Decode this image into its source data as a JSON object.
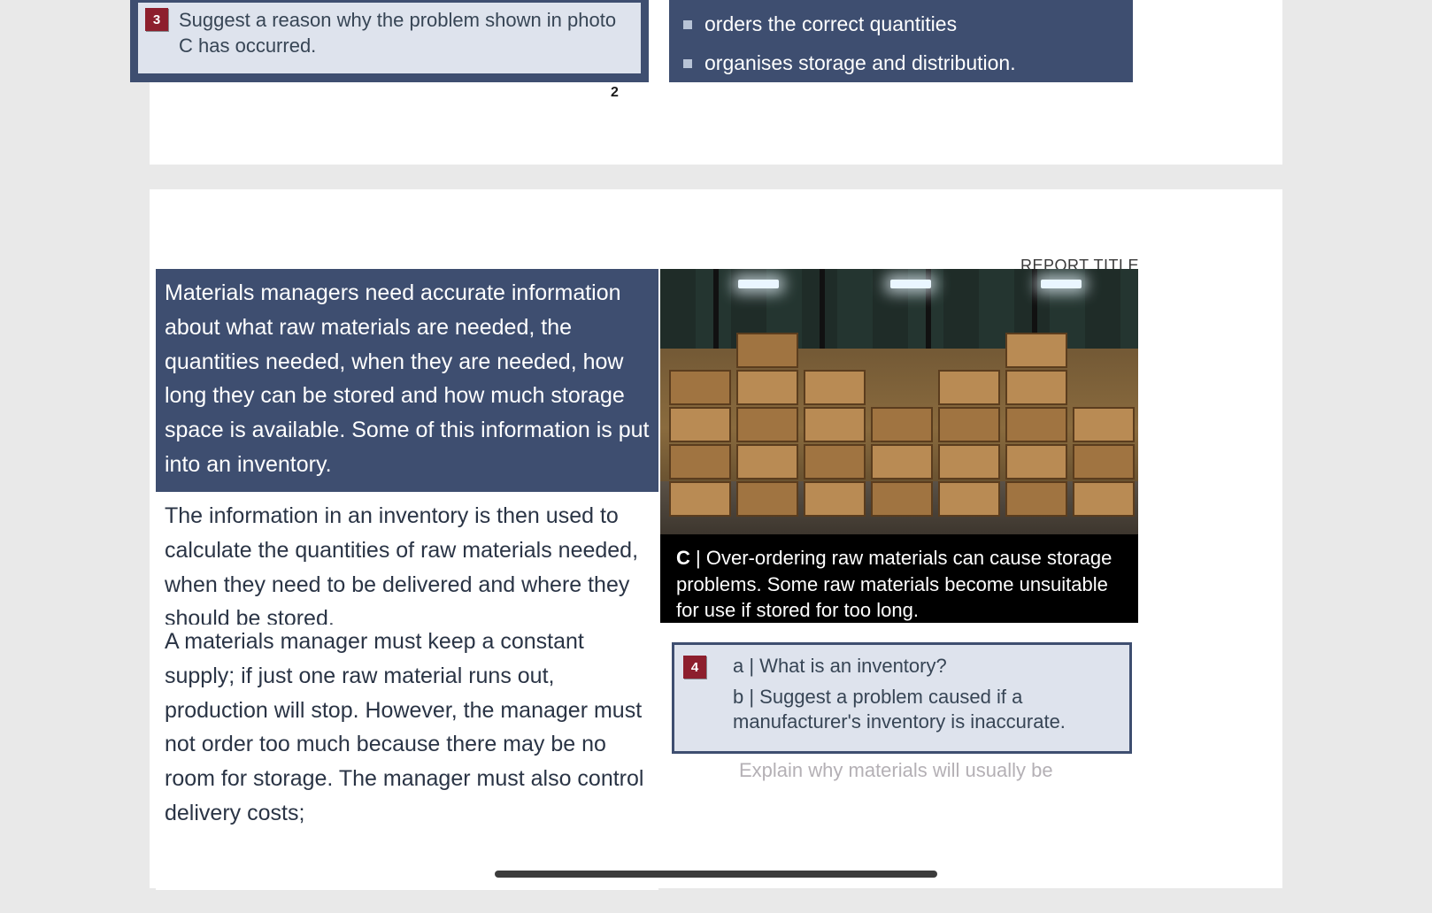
{
  "page1": {
    "question3": {
      "number": "3",
      "text": "Suggest a reason why the problem shown in photo C has occurred."
    },
    "bullets": {
      "b1": "orders the correct quantities",
      "b2": "organises storage and distribution."
    },
    "page_number": "2"
  },
  "page2": {
    "report_title_label": "REPORT TITLE",
    "para1": "Materials managers need accurate information about what raw materials are needed, the quantities needed, when they are needed, how long they can be stored and how much storage space is available. Some of this information is put into an inventory.",
    "para2": "The information in an inventory is then used to calculate the quantities of raw materials needed, when they need to be delivered and where they should be stored.",
    "para3": "A materials manager must keep a constant supply; if just one raw material runs out, production will stop. However, the manager must not order too much because there may be no room for storage. The manager must also control delivery costs;",
    "caption": {
      "label": "C",
      "sep": " | ",
      "text": "Over-ordering raw materials can cause storage problems. Some raw materials become unsuitable for use if stored for too long."
    },
    "question4": {
      "number": "4",
      "line_a": "a | What is an inventory?",
      "line_b": "b | Suggest a problem caused if a manufacturer's inventory is inaccurate."
    },
    "faded_q5_partial": "Explain why materials will usually be"
  }
}
